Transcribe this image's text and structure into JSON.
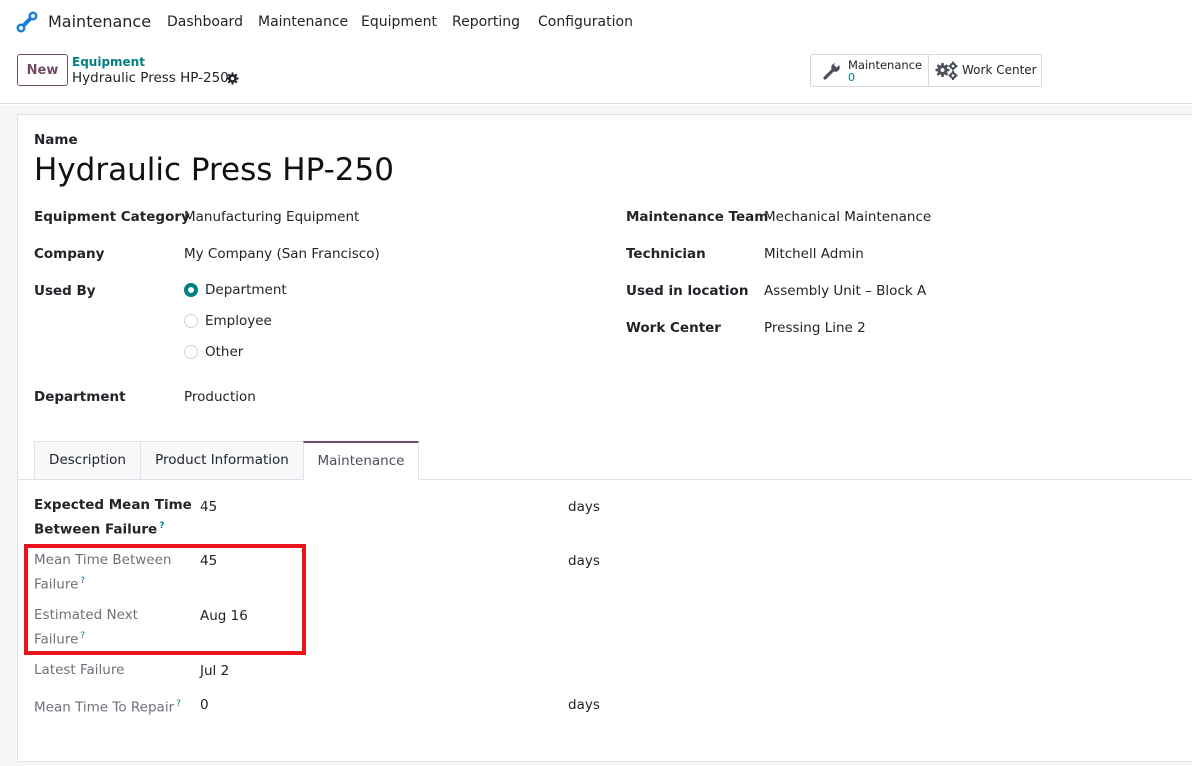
{
  "navbar": {
    "app_name": "Maintenance",
    "menus": [
      "Dashboard",
      "Maintenance",
      "Equipment",
      "Reporting",
      "Configuration"
    ],
    "logo_color": "#1a7ed6"
  },
  "control_panel": {
    "new_label": "New",
    "breadcrumb_parent": "Equipment",
    "breadcrumb_current": "Hydraulic Press HP-250",
    "stat_maintenance_label": "Maintenance",
    "stat_maintenance_count": "0",
    "stat_workcenter_label": "Work Center"
  },
  "form": {
    "name_label": "Name",
    "name_value": "Hydraulic Press HP-250",
    "left": {
      "category_label": "Equipment Category",
      "category_value": "Manufacturing Equipment",
      "company_label": "Company",
      "company_value": "My Company (San Francisco)",
      "used_by_label": "Used By",
      "used_by_options": [
        "Department",
        "Employee",
        "Other"
      ],
      "used_by_selected": "Department",
      "department_label": "Department",
      "department_value": "Production"
    },
    "right": {
      "team_label": "Maintenance Team",
      "team_value": "Mechanical Maintenance",
      "technician_label": "Technician",
      "technician_value": "Mitchell Admin",
      "location_label": "Used in location",
      "location_value": "Assembly Unit – Block A",
      "workcenter_label": "Work Center",
      "workcenter_value": "Pressing Line 2"
    }
  },
  "tabs": [
    "Description",
    "Product Information",
    "Maintenance"
  ],
  "active_tab": "Maintenance",
  "maintenance_tab": {
    "help_mark": "?",
    "expected_mtbf_label_1": "Expected Mean Time",
    "expected_mtbf_label_2": "Between Failure",
    "expected_mtbf_value": "45",
    "expected_mtbf_unit": "days",
    "mtbf_label_1": "Mean Time Between",
    "mtbf_label_2": "Failure",
    "mtbf_value": "45",
    "mtbf_unit": "days",
    "next_failure_label_1": "Estimated Next",
    "next_failure_label_2": "Failure",
    "next_failure_value": "Aug 16",
    "latest_failure_label": "Latest Failure",
    "latest_failure_value": "Jul 2",
    "mttr_label": "Mean Time To Repair",
    "mttr_value": "0",
    "mttr_unit": "days"
  },
  "colors": {
    "brand": "#714b67",
    "accent": "#017e84",
    "highlight": "#e8141c"
  }
}
